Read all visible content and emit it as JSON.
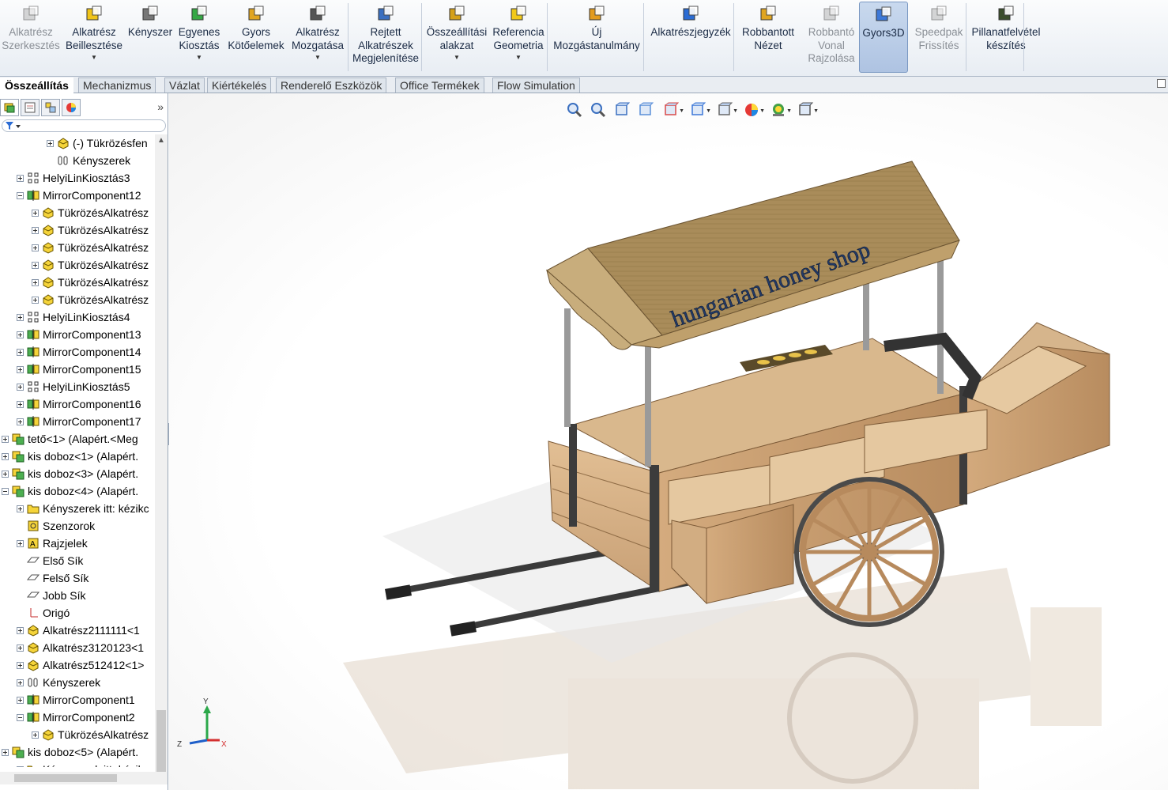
{
  "ribbon": {
    "buttons": [
      {
        "label": "Alkatrész Szerkesztés",
        "icon": "edit-component-icon",
        "enabled": false
      },
      {
        "label": "Alkatrész Beillesztése",
        "icon": "insert-component-icon",
        "enabled": true,
        "dropdown": true
      },
      {
        "label": "Kényszer",
        "icon": "mate-icon",
        "enabled": true
      },
      {
        "label": "Egyenes Kiosztás",
        "icon": "linear-pattern-icon",
        "enabled": true,
        "dropdown": true
      },
      {
        "label": "Gyors Kötőelemek",
        "icon": "smart-fasteners-icon",
        "enabled": true
      },
      {
        "label": "Alkatrész Mozgatása",
        "icon": "move-component-icon",
        "enabled": true,
        "dropdown": true
      },
      {
        "label": "Rejtett Alkatrészek Megjelenítése",
        "icon": "show-hidden-icon",
        "enabled": true
      },
      {
        "label": "Összeállítási alakzat",
        "icon": "assembly-feature-icon",
        "enabled": true,
        "dropdown": true
      },
      {
        "label": "Referencia Geometria",
        "icon": "reference-geometry-icon",
        "enabled": true,
        "dropdown": true
      },
      {
        "label": "Új Mozgástanulmány",
        "icon": "motion-study-icon",
        "enabled": true
      },
      {
        "label": "Alkatrészjegyzék",
        "icon": "bom-icon",
        "enabled": true
      },
      {
        "label": "Robbantott Nézet",
        "icon": "exploded-view-icon",
        "enabled": true
      },
      {
        "label": "Robbantó Vonal Rajzolása",
        "icon": "explode-line-icon",
        "enabled": false
      },
      {
        "label": "Gyors3D",
        "icon": "instant3d-icon",
        "enabled": true,
        "active": true
      },
      {
        "label": "Speedpak Frissítés",
        "icon": "speedpak-icon",
        "enabled": false
      },
      {
        "label": "Pillanatfelvétel készítés",
        "icon": "snapshot-icon",
        "enabled": true
      }
    ]
  },
  "tabs": [
    "Összeállítás",
    "Mechanizmus",
    "Vázlat",
    "Kiértékelés",
    "Renderelő Eszközök",
    "Office Termékek",
    "Flow Simulation"
  ],
  "active_tab": "Összeállítás",
  "panel": {
    "more_glyph": "»",
    "tree": [
      {
        "label": "(-) Tükrözésfen",
        "icon": "part-icon",
        "level": 3,
        "expand": "plus"
      },
      {
        "label": "Kényszerek",
        "icon": "mates-icon",
        "level": 3,
        "expand": "none"
      },
      {
        "label": "HelyiLinKiosztás3",
        "icon": "pattern-icon",
        "level": 1,
        "expand": "plus"
      },
      {
        "label": "MirrorComponent12",
        "icon": "mirror-icon",
        "level": 1,
        "expand": "minus"
      },
      {
        "label": "TükrözésAlkatrész",
        "icon": "part-icon",
        "level": 2,
        "expand": "plus"
      },
      {
        "label": "TükrözésAlkatrész",
        "icon": "part-icon",
        "level": 2,
        "expand": "plus"
      },
      {
        "label": "TükrözésAlkatrész",
        "icon": "part-icon",
        "level": 2,
        "expand": "plus"
      },
      {
        "label": "TükrözésAlkatrész",
        "icon": "part-icon",
        "level": 2,
        "expand": "plus"
      },
      {
        "label": "TükrözésAlkatrész",
        "icon": "part-icon",
        "level": 2,
        "expand": "plus"
      },
      {
        "label": "TükrözésAlkatrész",
        "icon": "part-icon",
        "level": 2,
        "expand": "plus"
      },
      {
        "label": "HelyiLinKiosztás4",
        "icon": "pattern-icon",
        "level": 1,
        "expand": "plus"
      },
      {
        "label": "MirrorComponent13",
        "icon": "mirror-icon",
        "level": 1,
        "expand": "plus"
      },
      {
        "label": "MirrorComponent14",
        "icon": "mirror-icon",
        "level": 1,
        "expand": "plus"
      },
      {
        "label": "MirrorComponent15",
        "icon": "mirror-icon",
        "level": 1,
        "expand": "plus"
      },
      {
        "label": "HelyiLinKiosztás5",
        "icon": "pattern-icon",
        "level": 1,
        "expand": "plus"
      },
      {
        "label": "MirrorComponent16",
        "icon": "mirror-icon",
        "level": 1,
        "expand": "plus"
      },
      {
        "label": "MirrorComponent17",
        "icon": "mirror-icon",
        "level": 1,
        "expand": "plus"
      },
      {
        "label": "tető<1> (Alapért.<Meg",
        "icon": "assembly-icon",
        "level": 0,
        "expand": "plus"
      },
      {
        "label": "kis doboz<1> (Alapért.",
        "icon": "assembly-icon",
        "level": 0,
        "expand": "plus"
      },
      {
        "label": "kis doboz<3> (Alapért.",
        "icon": "assembly-icon",
        "level": 0,
        "expand": "plus"
      },
      {
        "label": "kis doboz<4> (Alapért.",
        "icon": "assembly-icon",
        "level": 0,
        "expand": "minus"
      },
      {
        "label": "Kényszerek itt: kézikc",
        "icon": "mates-folder-icon",
        "level": 1,
        "expand": "plus"
      },
      {
        "label": "Szenzorok",
        "icon": "sensor-icon",
        "level": 1,
        "expand": "none"
      },
      {
        "label": "Rajzjelek",
        "icon": "annotation-icon",
        "level": 1,
        "expand": "plus"
      },
      {
        "label": "Első Sík",
        "icon": "plane-icon",
        "level": 1,
        "expand": "none"
      },
      {
        "label": "Felső Sík",
        "icon": "plane-icon",
        "level": 1,
        "expand": "none"
      },
      {
        "label": "Jobb Sík",
        "icon": "plane-icon",
        "level": 1,
        "expand": "none"
      },
      {
        "label": "Origó",
        "icon": "origin-icon",
        "level": 1,
        "expand": "none"
      },
      {
        "label": "Alkatrész2111111<1",
        "icon": "part-icon",
        "level": 1,
        "expand": "plus"
      },
      {
        "label": "Alkatrész3120123<1",
        "icon": "part-icon",
        "level": 1,
        "expand": "plus"
      },
      {
        "label": "Alkatrész512412<1>",
        "icon": "part-icon",
        "level": 1,
        "expand": "plus"
      },
      {
        "label": "Kényszerek",
        "icon": "mates-icon",
        "level": 1,
        "expand": "plus"
      },
      {
        "label": "MirrorComponent1",
        "icon": "mirror-icon",
        "level": 1,
        "expand": "plus"
      },
      {
        "label": "MirrorComponent2",
        "icon": "mirror-icon",
        "level": 1,
        "expand": "minus"
      },
      {
        "label": "TükrözésAlkatrész",
        "icon": "part-icon",
        "level": 2,
        "expand": "plus"
      },
      {
        "label": "kis doboz<5> (Alapért.",
        "icon": "assembly-icon",
        "level": 0,
        "expand": "plus"
      },
      {
        "label": "Kényszerek itt: kézikc",
        "icon": "mates-folder-icon",
        "level": 1,
        "expand": "plus"
      }
    ]
  },
  "heads_up_toolbar": [
    "zoom-to-fit-icon",
    "zoom-to-area-icon",
    "previous-view-icon",
    "section-view-icon",
    "view-orientation-icon",
    "display-style-icon",
    "hide-show-items-icon",
    "edit-appearance-icon",
    "apply-scene-icon",
    "view-settings-icon"
  ],
  "model": {
    "sign_text": "hungarian honey shop",
    "wood_color": "#c79c6e",
    "roof_color": "#a98c5a",
    "metal_color": "#4a4a4a"
  },
  "triad": {
    "x": "X",
    "y": "Y",
    "z": "Z"
  }
}
